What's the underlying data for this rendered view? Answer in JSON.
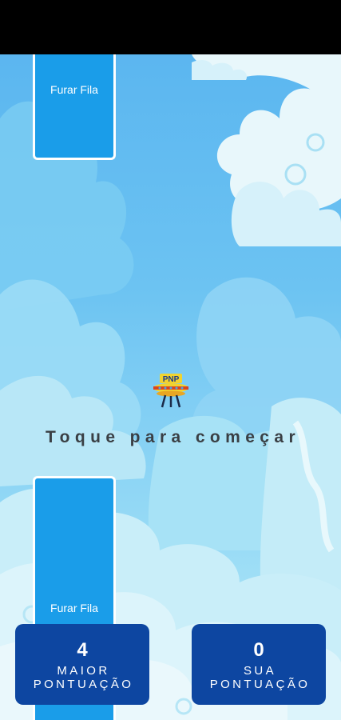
{
  "game": {
    "start_prompt": "Toque para começar",
    "pipe_top_label": "Furar Fila",
    "pipe_bottom_label": "Furar Fila",
    "player_badge": "PNP"
  },
  "scores": {
    "best": {
      "value": "4",
      "label_line1": "MAIOR",
      "label_line2": "PONTUAÇÃO"
    },
    "current": {
      "value": "0",
      "label_line1": "SUA",
      "label_line2": "PONTUAÇÃO"
    }
  },
  "colors": {
    "pipe": "#1a9de9",
    "score_card": "#0d46a1",
    "sky_top": "#5bb6f0",
    "sky_bottom": "#b8ecf7",
    "prompt_text": "#3a3f44"
  },
  "icons": {
    "player": "ufo-icon"
  }
}
